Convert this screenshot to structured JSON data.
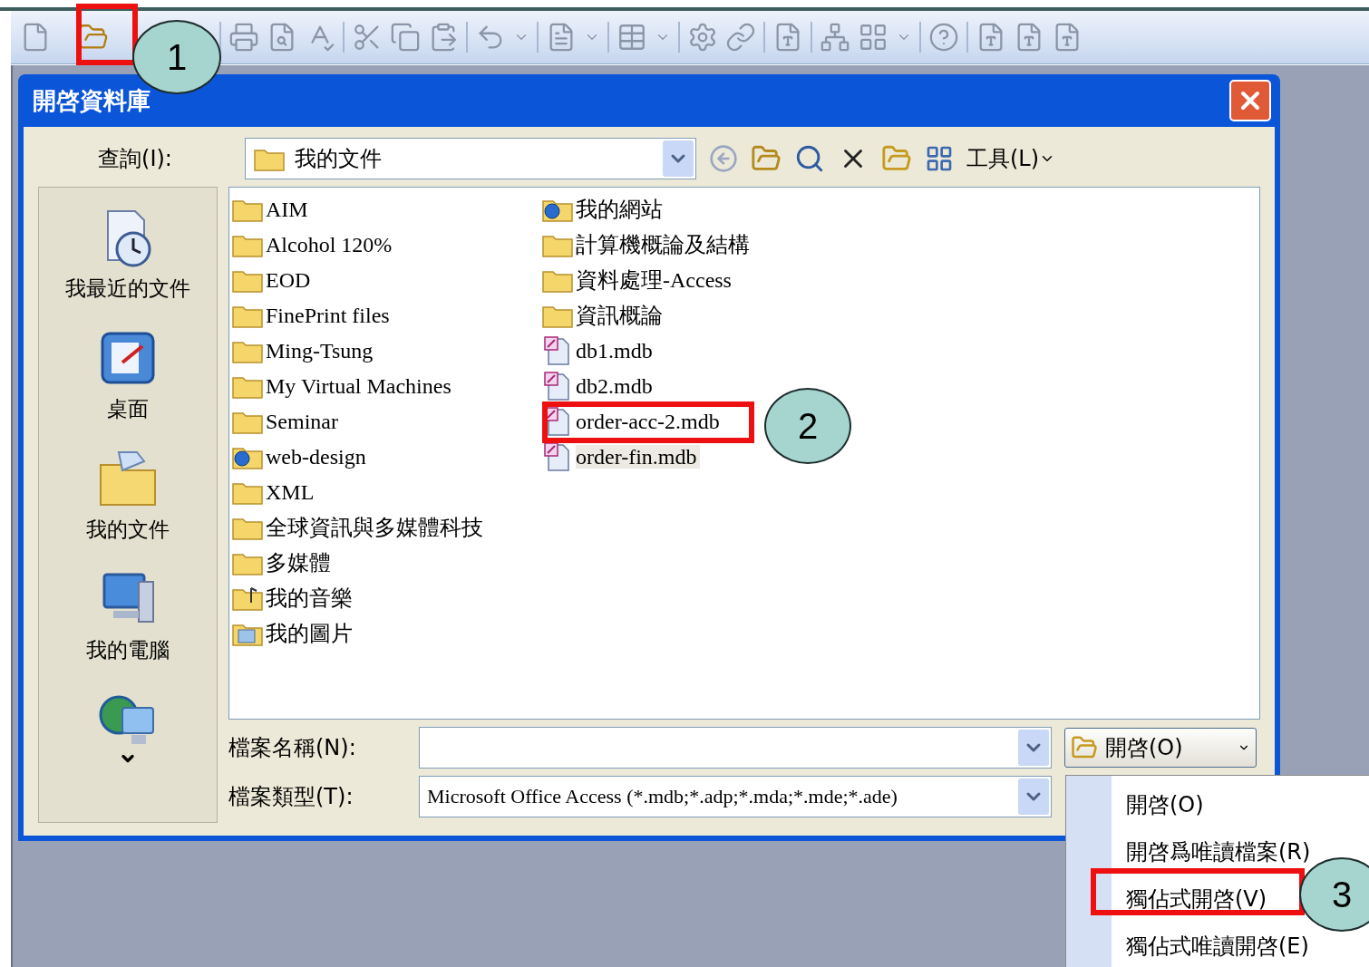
{
  "dialog": {
    "title": "開啓資料庫",
    "look_in": {
      "label": "查詢(I):",
      "value": "我的文件"
    },
    "tools_menu": "工具(L)",
    "places": [
      {
        "label": "我最近的文件",
        "kind": "recent"
      },
      {
        "label": "桌面",
        "kind": "desktop"
      },
      {
        "label": "我的文件",
        "kind": "documents"
      },
      {
        "label": "我的電腦",
        "kind": "computer"
      },
      {
        "kind": "network"
      }
    ],
    "files": [
      {
        "name": "AIM",
        "kind": "folder",
        "selected": false
      },
      {
        "name": "Alcohol 120%",
        "kind": "folder",
        "selected": false
      },
      {
        "name": "EOD",
        "kind": "folder",
        "selected": false
      },
      {
        "name": "FinePrint files",
        "kind": "folder",
        "selected": false
      },
      {
        "name": "Ming-Tsung",
        "kind": "folder",
        "selected": false
      },
      {
        "name": "My Virtual Machines",
        "kind": "folder",
        "selected": false
      },
      {
        "name": "Seminar",
        "kind": "folder",
        "selected": false
      },
      {
        "name": "web-design",
        "kind": "web",
        "selected": false
      },
      {
        "name": "XML",
        "kind": "folder",
        "selected": false
      },
      {
        "name": "全球資訊與多媒體科技",
        "kind": "folder",
        "selected": false
      },
      {
        "name": "多媒體",
        "kind": "folder",
        "selected": false
      },
      {
        "name": "我的音樂",
        "kind": "music",
        "selected": false
      },
      {
        "name": "我的圖片",
        "kind": "pictures",
        "selected": false
      },
      {
        "name": "我的網站",
        "kind": "web",
        "selected": false
      },
      {
        "name": "計算機概論及結構",
        "kind": "folder",
        "selected": false
      },
      {
        "name": "資料處理-Access",
        "kind": "folder",
        "selected": false
      },
      {
        "name": "資訊概論",
        "kind": "folder",
        "selected": false
      },
      {
        "name": "db1.mdb",
        "kind": "mdb",
        "selected": false
      },
      {
        "name": "db2.mdb",
        "kind": "mdb",
        "selected": false
      },
      {
        "name": "order-acc-2.mdb",
        "kind": "mdb",
        "selected": false
      },
      {
        "name": "order-fin.mdb",
        "kind": "mdb",
        "selected": true
      }
    ],
    "file_name": {
      "label": "檔案名稱(N):"
    },
    "file_type": {
      "label": "檔案類型(T):",
      "value": "Microsoft Office Access (*.mdb;*.adp;*.mda;*.mde;*.ade)"
    },
    "open_button": "開啓(O)"
  },
  "open_menu": [
    "開啓(O)",
    "開啓爲唯讀檔案(R)",
    "獨佔式開啓(V)",
    "獨佔式唯讀開啓(E)"
  ],
  "callouts": [
    {
      "label": "1"
    },
    {
      "label": "2"
    },
    {
      "label": "3"
    }
  ]
}
